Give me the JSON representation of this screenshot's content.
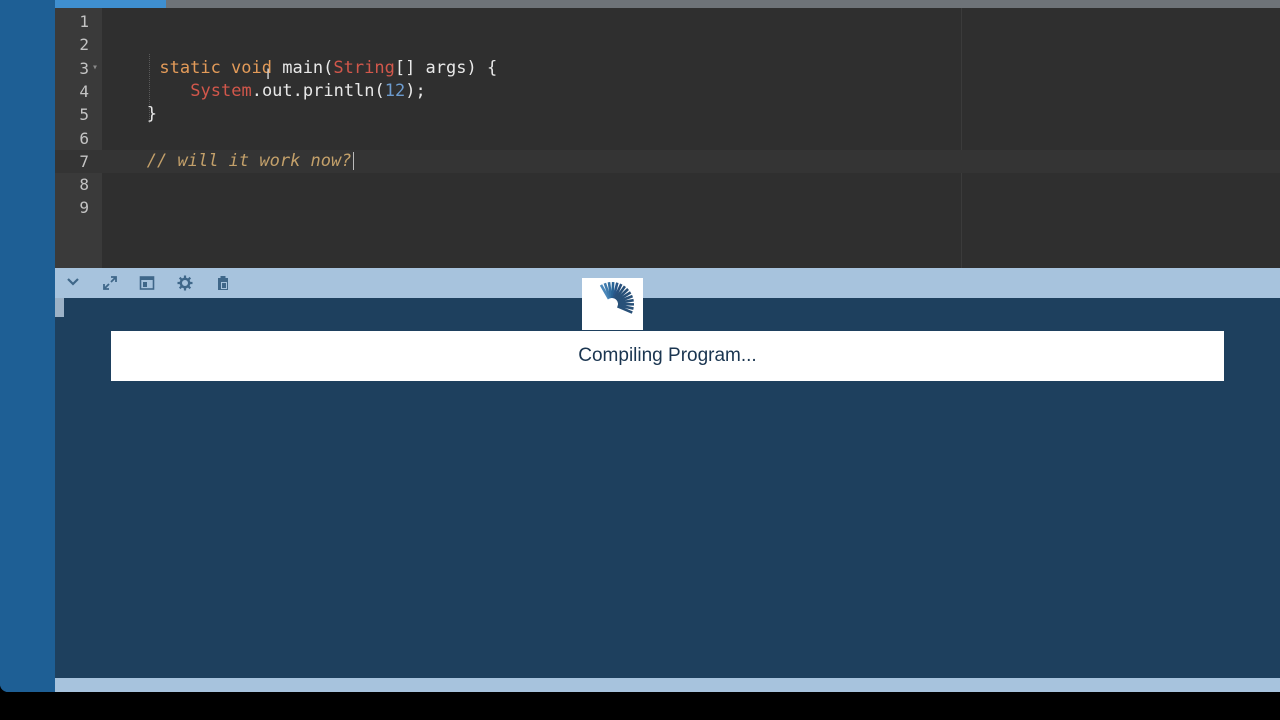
{
  "editor": {
    "active_line": 7,
    "lines": [
      {
        "number": "1",
        "fold": "",
        "tokens": []
      },
      {
        "number": "2",
        "fold": "",
        "tokens": []
      },
      {
        "number": "3",
        "fold": "▾",
        "tokens": [
          {
            "text": "static void",
            "cls": "kw"
          },
          {
            "text": " main(",
            "cls": ""
          },
          {
            "text": "String",
            "cls": "type"
          },
          {
            "text": "[] args) {",
            "cls": ""
          }
        ]
      },
      {
        "number": "4",
        "fold": "",
        "tokens": [
          {
            "text": "  ",
            "cls": ""
          },
          {
            "text": "System",
            "cls": "type"
          },
          {
            "text": ".out.println(",
            "cls": ""
          },
          {
            "text": "12",
            "cls": "num"
          },
          {
            "text": ");",
            "cls": ""
          }
        ]
      },
      {
        "number": "5",
        "fold": "",
        "tokens": [
          {
            "text": "}",
            "cls": ""
          }
        ]
      },
      {
        "number": "6",
        "fold": "",
        "tokens": []
      },
      {
        "number": "7",
        "fold": "",
        "tokens": [
          {
            "text": "// will it work now?",
            "cls": "comment"
          }
        ]
      },
      {
        "number": "8",
        "fold": "",
        "tokens": []
      },
      {
        "number": "9",
        "fold": "",
        "tokens": []
      }
    ]
  },
  "toolbar": {
    "buttons": [
      {
        "name": "collapse-panel-button",
        "icon": "chevron-down-icon",
        "glyph": "⌄"
      },
      {
        "name": "expand-panel-button",
        "icon": "expand-arrows-icon",
        "glyph": "⤢"
      },
      {
        "name": "layout-panel-button",
        "icon": "panel-layout-icon",
        "glyph": "◫"
      },
      {
        "name": "settings-button",
        "icon": "gear-icon",
        "glyph": "⚙"
      },
      {
        "name": "clipboard-button",
        "icon": "clipboard-icon",
        "glyph": "📋"
      }
    ]
  },
  "console": {
    "status_text": "Compiling Program..."
  },
  "colors": {
    "keyword": "#e39b59",
    "type": "#d2574b",
    "number": "#6d9ccf",
    "comment": "#c3a06a",
    "console_bg": "#1e405e",
    "toolbar_bg": "#a7c3dd"
  }
}
